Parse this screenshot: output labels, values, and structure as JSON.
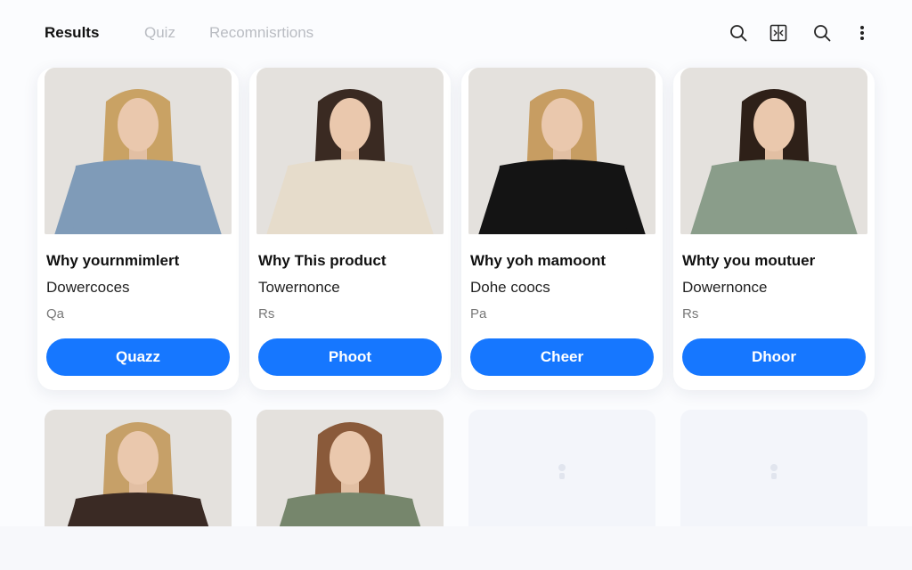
{
  "header": {
    "tabs": [
      {
        "label": "Results",
        "active": true
      },
      {
        "label": "Quiz",
        "active": false
      },
      {
        "label": "Recomnisrtions",
        "active": false
      }
    ],
    "icons": [
      "search-icon",
      "compare-icon",
      "search-icon",
      "more-icon"
    ]
  },
  "products": [
    {
      "title": "Why yournmimlert",
      "subtitle": "Dowercoces",
      "price": "Qa",
      "button": "Quazz",
      "sweater_color": "#7f9bb8"
    },
    {
      "title": "Why This product",
      "subtitle": "Towernonce",
      "price": "Rs",
      "button": "Phoot",
      "sweater_color": "#e6dccb"
    },
    {
      "title": "Why yoh mamoont",
      "subtitle": "Dohe coocs",
      "price": "Pa",
      "button": "Cheer",
      "sweater_color": "#141414"
    },
    {
      "title": "Whty you moutuer",
      "subtitle": "Dowernonce",
      "price": "Rs",
      "button": "Dhoor",
      "sweater_color": "#8a9d8a"
    }
  ],
  "second_row": [
    {
      "type": "photo",
      "sweater_color": "#3a2a24"
    },
    {
      "type": "photo",
      "sweater_color": "#76866c"
    },
    {
      "type": "placeholder"
    },
    {
      "type": "placeholder"
    }
  ],
  "colors": {
    "accent": "#1677ff",
    "muted_tab": "#b9bcc2"
  }
}
